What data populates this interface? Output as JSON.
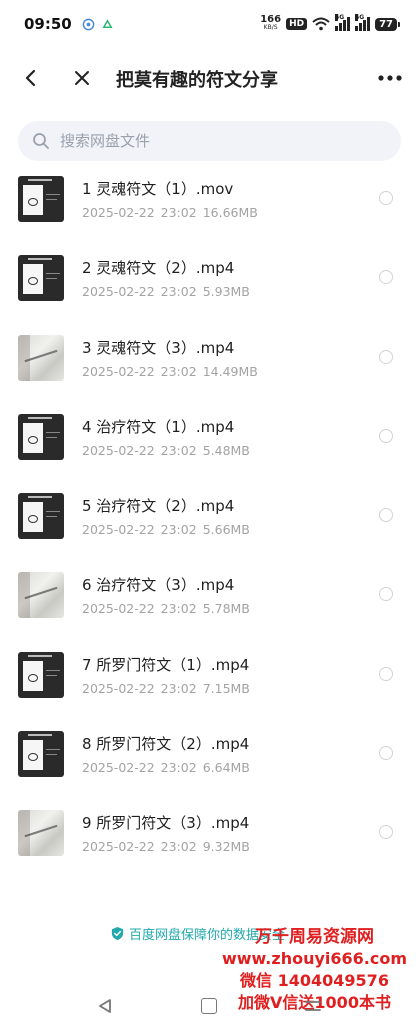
{
  "status_bar": {
    "time": "09:50",
    "net_speed_value": "166",
    "net_speed_unit": "KB/S",
    "hd_label": "HD",
    "sim1_label": "5G",
    "sim2_label": "5G",
    "battery_level": "77"
  },
  "header": {
    "title": "把莫有趣的符文分享"
  },
  "search": {
    "placeholder": "搜索网盘文件"
  },
  "files": [
    {
      "name": "1 灵魂符文（1）.mov",
      "date": "2025-02-22",
      "time": "23:02",
      "size": "16.66MB",
      "thumb": "dark"
    },
    {
      "name": "2 灵魂符文（2）.mp4",
      "date": "2025-02-22",
      "time": "23:02",
      "size": "5.93MB",
      "thumb": "dark"
    },
    {
      "name": "3 灵魂符文（3）.mp4",
      "date": "2025-02-22",
      "time": "23:02",
      "size": "14.49MB",
      "thumb": "photo"
    },
    {
      "name": "4 治疗符文（1）.mp4",
      "date": "2025-02-22",
      "time": "23:02",
      "size": "5.48MB",
      "thumb": "dark"
    },
    {
      "name": "5 治疗符文（2）.mp4",
      "date": "2025-02-22",
      "time": "23:02",
      "size": "5.66MB",
      "thumb": "dark"
    },
    {
      "name": "6 治疗符文（3）.mp4",
      "date": "2025-02-22",
      "time": "23:02",
      "size": "5.78MB",
      "thumb": "photo"
    },
    {
      "name": "7 所罗门符文（1）.mp4",
      "date": "2025-02-22",
      "time": "23:02",
      "size": "7.15MB",
      "thumb": "dark"
    },
    {
      "name": "8 所罗门符文（2）.mp4",
      "date": "2025-02-22",
      "time": "23:02",
      "size": "6.64MB",
      "thumb": "dark"
    },
    {
      "name": "9 所罗门符文（3）.mp4",
      "date": "2025-02-22",
      "time": "23:02",
      "size": "9.32MB",
      "thumb": "photo"
    }
  ],
  "footer": {
    "security_note": "百度网盘保障你的数据安全"
  },
  "watermark": {
    "line1": "万千周易资源网",
    "line2": "www.zhouyi666.com",
    "line3": "微信 1404049576",
    "line4": "加微V信送1000本书"
  },
  "colors": {
    "accent": "#22a8ad",
    "watermark": "#e02020",
    "meta_text": "#a3a3a3",
    "search_bg": "#f1f3f8"
  }
}
